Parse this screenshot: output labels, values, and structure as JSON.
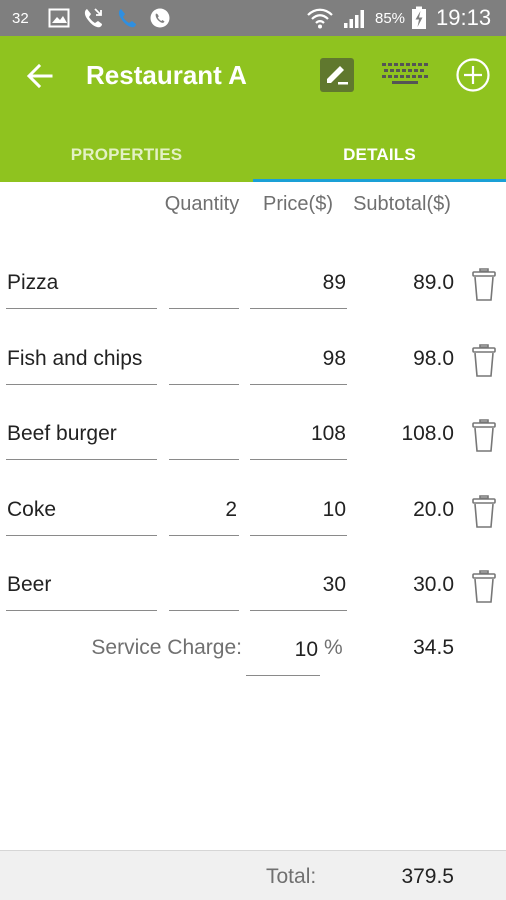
{
  "status_bar": {
    "notification_count": "32",
    "battery_percent": "85%",
    "time": "19:13"
  },
  "app_bar": {
    "title": "Restaurant A",
    "icons": [
      "back-arrow-icon",
      "edit-icon",
      "keyboard-icon",
      "add-circle-icon"
    ],
    "color": "#8fc31f"
  },
  "tabs": [
    {
      "label": "PROPERTIES",
      "selected": false
    },
    {
      "label": "DETAILS",
      "selected": true
    }
  ],
  "table": {
    "headers": {
      "quantity": "Quantity",
      "price": "Price($)",
      "subtotal": "Subtotal($)"
    },
    "items": [
      {
        "name": "Pizza",
        "quantity": "",
        "price": "89",
        "subtotal": "89.0"
      },
      {
        "name": "Fish and chips",
        "quantity": "",
        "price": "98",
        "subtotal": "98.0"
      },
      {
        "name": "Beef burger",
        "quantity": "",
        "price": "108",
        "subtotal": "108.0"
      },
      {
        "name": "Coke",
        "quantity": "2",
        "price": "10",
        "subtotal": "20.0"
      },
      {
        "name": "Beer",
        "quantity": "",
        "price": "30",
        "subtotal": "30.0"
      }
    ]
  },
  "service": {
    "label": "Service Charge:",
    "value": "10",
    "unit": "%",
    "subtotal": "34.5"
  },
  "footer": {
    "total_label": "Total:",
    "total_value": "379.5"
  }
}
